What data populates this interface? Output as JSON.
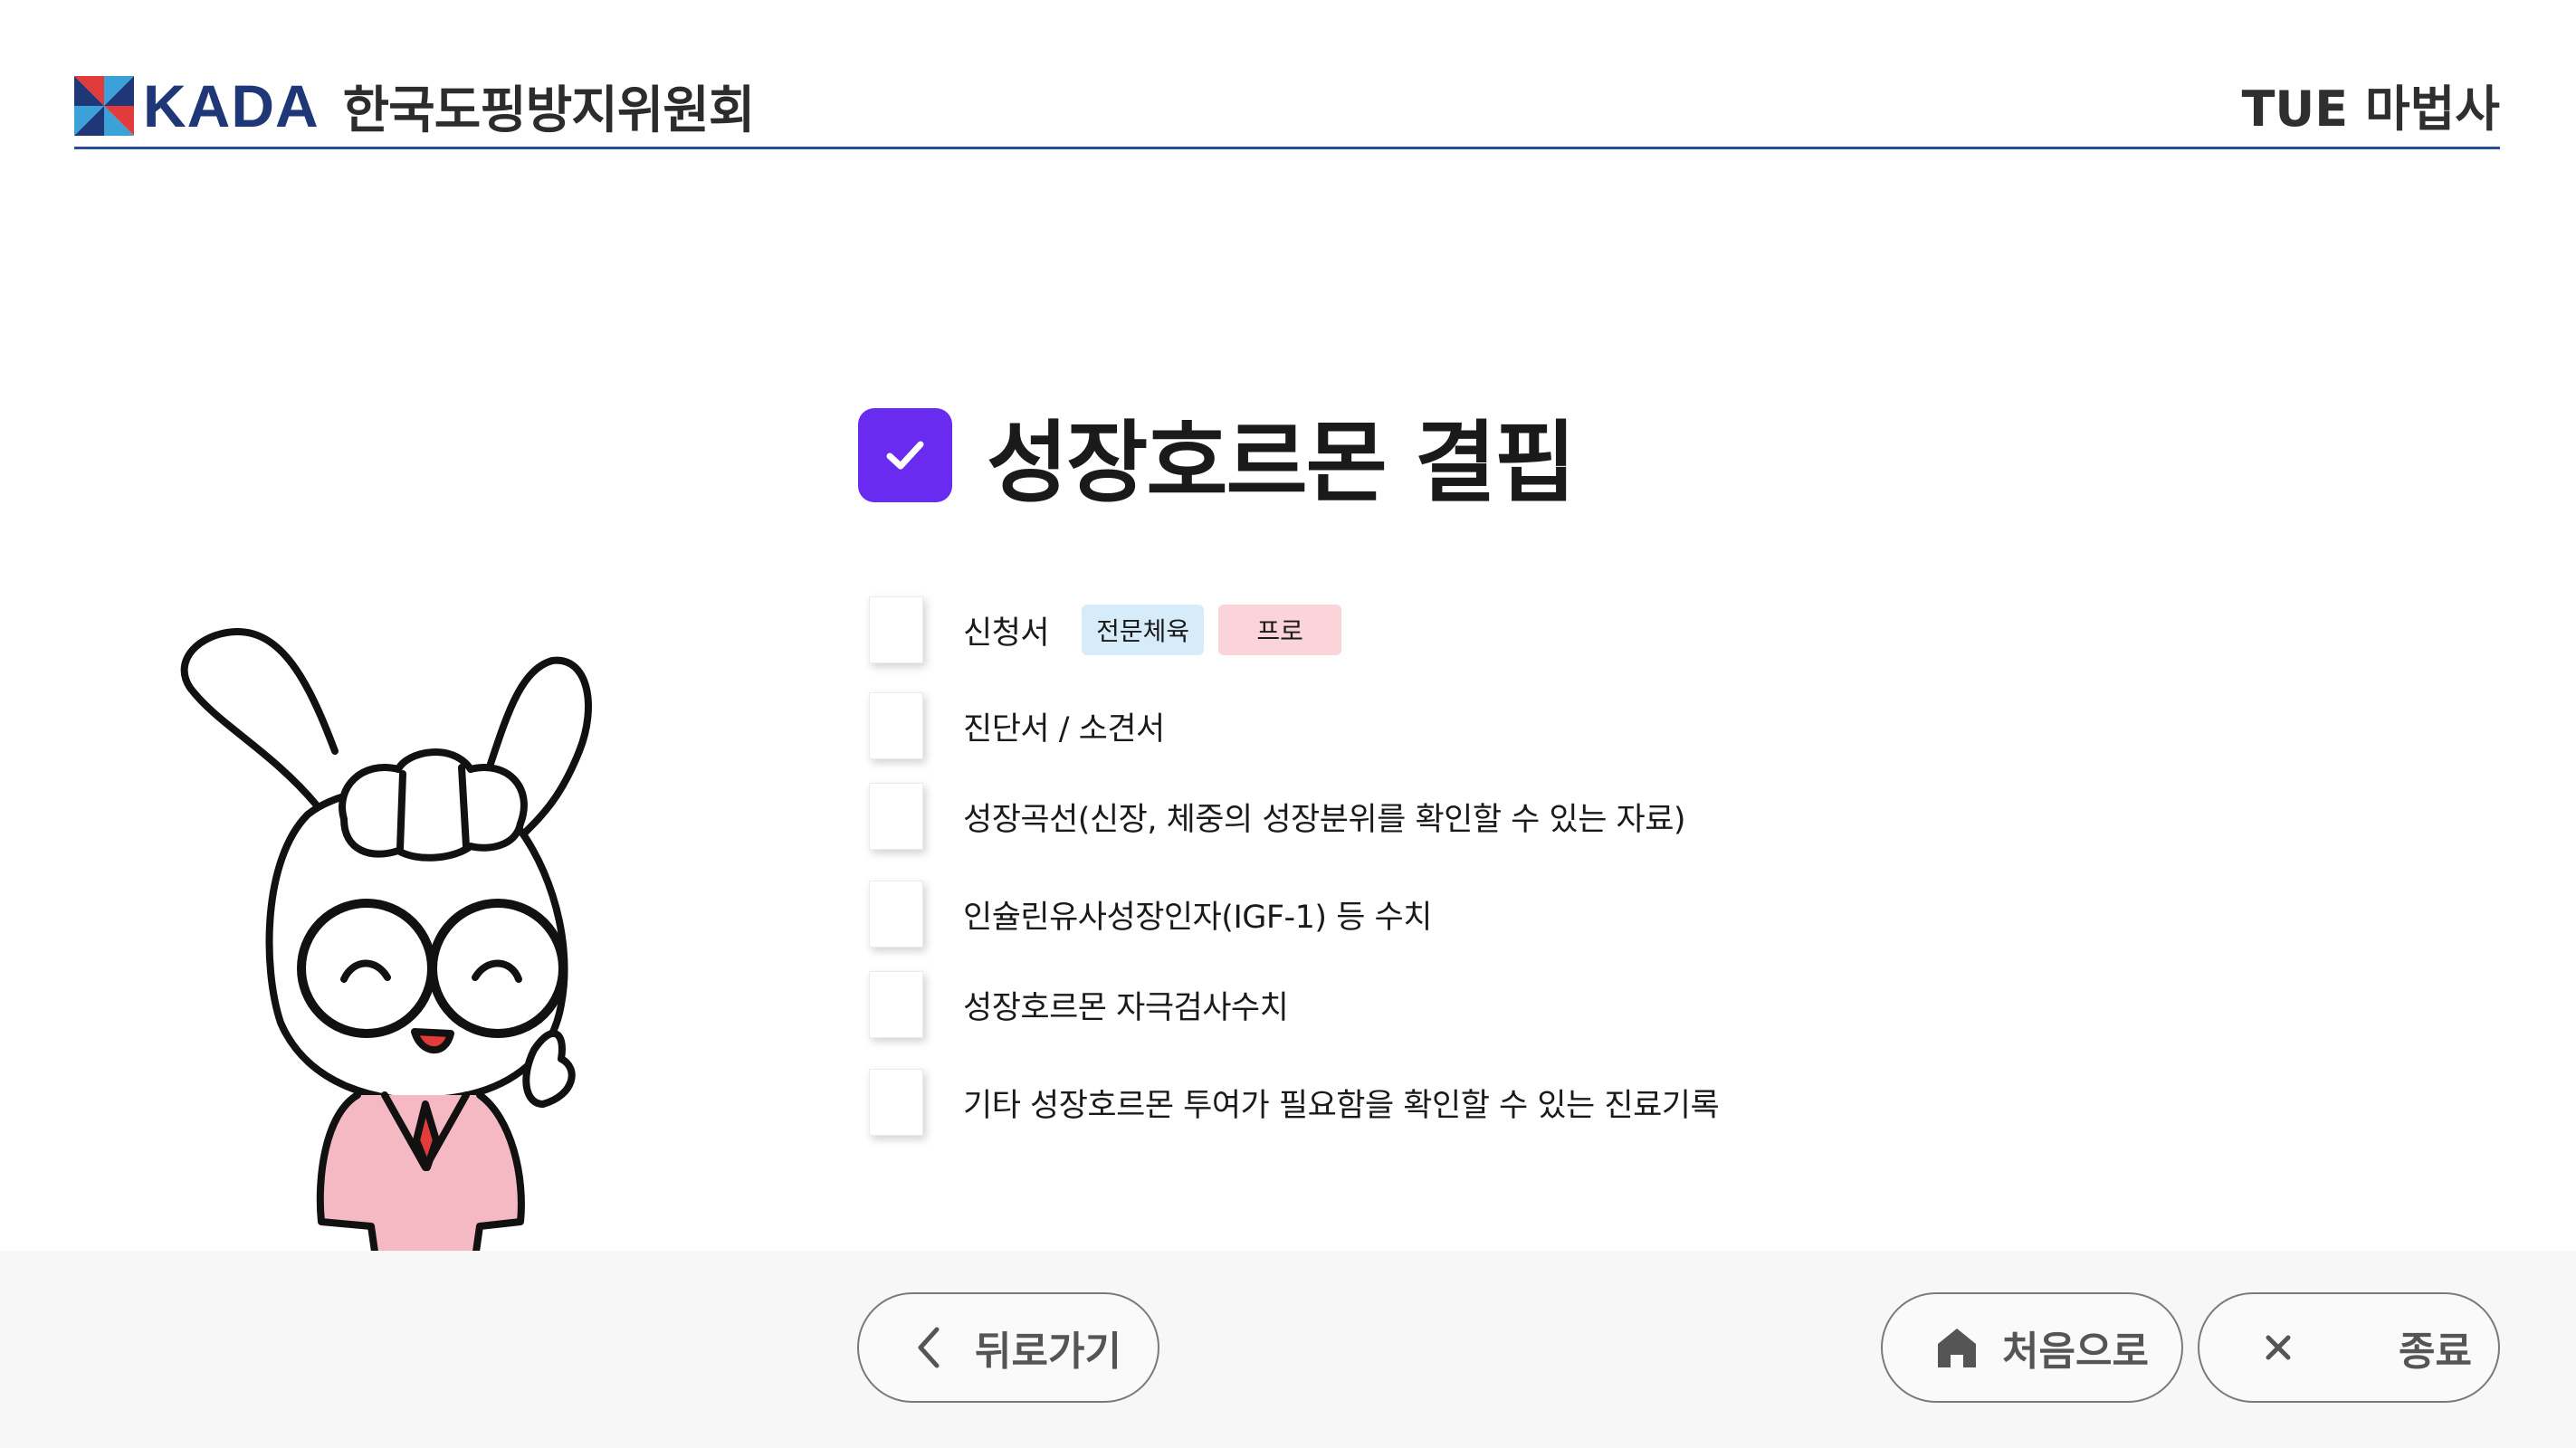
{
  "header": {
    "logo_text": "KADA",
    "org_name": "한국도핑방지위원회",
    "app_title": "TUE 마법사"
  },
  "page": {
    "title": "성장호르몬 결핍"
  },
  "checklist": [
    {
      "label": "신청서",
      "badges": [
        "전문체육",
        "프로"
      ],
      "checked": false
    },
    {
      "label": "진단서 / 소견서",
      "checked": false
    },
    {
      "label": "성장곡선(신장, 체중의 성장분위를 확인할 수 있는 자료)",
      "checked": false
    },
    {
      "label": "인슐린유사성장인자(IGF-1) 등 수치",
      "checked": false
    },
    {
      "label": "성장호르몬 자극검사수치",
      "checked": false
    },
    {
      "label": "기타 성장호르몬 투여가 필요함을 확인할 수 있는 진료기록",
      "checked": false
    }
  ],
  "footer": {
    "back_label": "뒤로가기",
    "home_label": "처음으로",
    "exit_label": "종료"
  },
  "colors": {
    "accent": "#6a2bf0",
    "header_rule": "#2a4d9b",
    "badge_blue": "#d6ecf9",
    "badge_pink": "#fad4d8"
  },
  "icons": {
    "title": "check-icon",
    "back": "chevron-left-icon",
    "home": "home-icon",
    "exit": "close-icon"
  }
}
